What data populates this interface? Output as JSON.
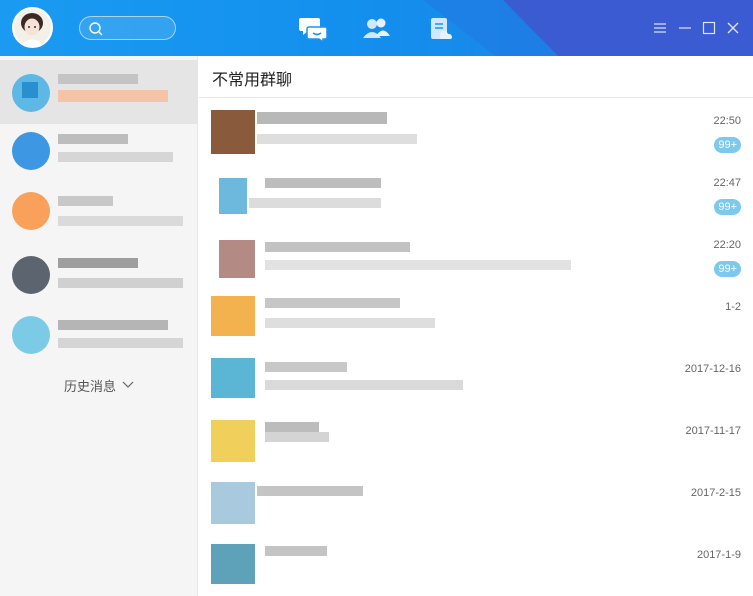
{
  "header": {
    "search_placeholder": "",
    "nav_tabs": [
      "message-tab",
      "contacts-tab",
      "notes-tab"
    ]
  },
  "sidebar": {
    "history_label": "历史消息"
  },
  "main": {
    "title": "不常用群聊",
    "rows": [
      {
        "time": "22:50",
        "badge": "99+"
      },
      {
        "time": "22:47",
        "badge": "99+"
      },
      {
        "time": "22:20",
        "badge": "99+"
      },
      {
        "time": "1-2",
        "badge": ""
      },
      {
        "time": "2017-12-16",
        "badge": ""
      },
      {
        "time": "2017-11-17",
        "badge": ""
      },
      {
        "time": "2017-2-15",
        "badge": ""
      },
      {
        "time": "2017-1-9",
        "badge": ""
      }
    ]
  },
  "colors": {
    "accent": "#1a9bf1",
    "badge": "#7dc9ee",
    "sidebar_bg": "#f5f5f5"
  }
}
